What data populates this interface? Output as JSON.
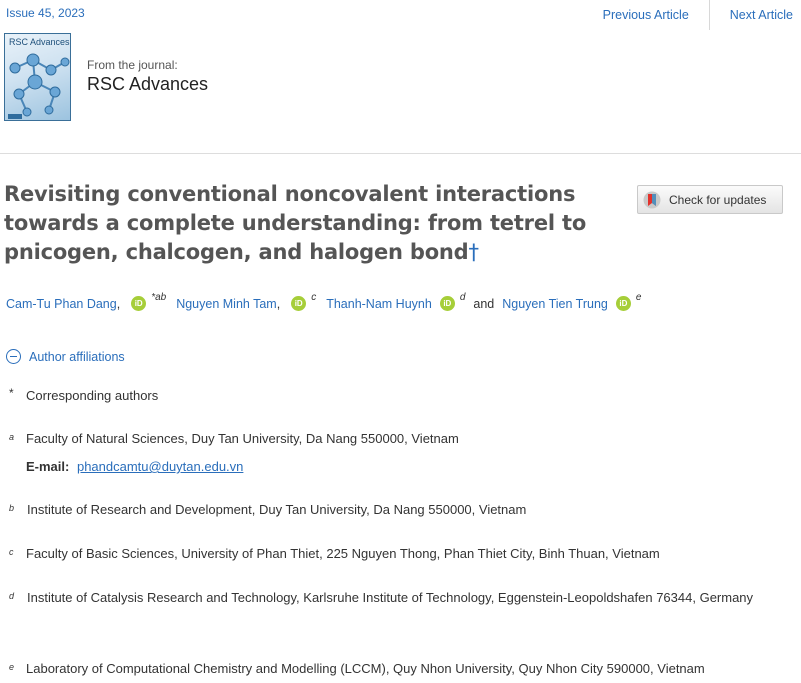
{
  "header": {
    "issue": "Issue 45, 2023",
    "previous_article": "Previous Article",
    "next_article": "Next Article"
  },
  "journal": {
    "cover_title": "RSC Advances",
    "from_label": "From the journal:",
    "name": "RSC Advances"
  },
  "article": {
    "title": "Revisiting conventional noncovalent interactions towards a complete understanding: from tetrel to pnicogen, chalcogen, and halogen bond",
    "title_dagger": "†",
    "check_updates": "Check for updates"
  },
  "authors": [
    {
      "name": "Cam-Tu Phan Dang",
      "sup": "*ab",
      "orcid": "iD"
    },
    {
      "name": "Nguyen Minh Tam",
      "sup": "c",
      "orcid": "iD"
    },
    {
      "name": "Thanh-Nam Huynh",
      "sup": "d",
      "orcid": "iD"
    },
    {
      "name": "Nguyen Tien Trung",
      "sup": "e",
      "orcid": "iD"
    }
  ],
  "authors_and": "and",
  "affiliations_toggle": "Author affiliations",
  "affiliations": [
    {
      "mark": "*",
      "text": "Corresponding authors"
    },
    {
      "mark": "a",
      "text": "Faculty of Natural Sciences, Duy Tan University, Da Nang 550000, Vietnam",
      "email_label": "E-mail:",
      "email": "phandcamtu@duytan.edu.vn"
    },
    {
      "mark": "b",
      "text": "Institute of Research and Development, Duy Tan University, Da Nang 550000, Vietnam"
    },
    {
      "mark": "c",
      "text": "Faculty of Basic Sciences, University of Phan Thiet, 225 Nguyen Thong, Phan Thiet City, Binh Thuan, Vietnam"
    },
    {
      "mark": "d",
      "text": "Institute of Catalysis Research and Technology, Karlsruhe Institute of Technology, Eggenstein-Leopoldshafen 76344, Germany"
    },
    {
      "mark": "e",
      "text": "Laboratory of Computational Chemistry and Modelling (LCCM), Quy Nhon University, Quy Nhon City 590000, Vietnam"
    }
  ]
}
